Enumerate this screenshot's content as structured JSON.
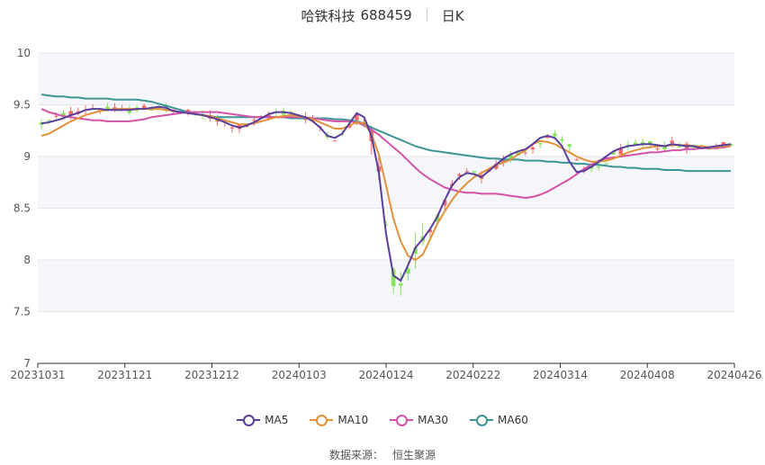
{
  "header": {
    "stock_name": "哈铁科技",
    "stock_code": "688459",
    "period": "日K"
  },
  "footer": {
    "source_label": "数据来源：",
    "source_name": "恒生聚源"
  },
  "colors": {
    "up": "#f26b6b",
    "down": "#86e35a",
    "band": "#f5f6fa",
    "grid": "#e4e6ee"
  },
  "chart_data": {
    "type": "candlestick",
    "y_ticks": [
      "10",
      "9.5",
      "9",
      "8.5",
      "8",
      "7.5",
      "7"
    ],
    "ylim": [
      7,
      10
    ],
    "x_tick_labels": [
      "20231031",
      "20231121",
      "20231212",
      "20240103",
      "20240124",
      "20240222",
      "20240314",
      "20240408",
      "20240426"
    ],
    "legend": [
      {
        "name": "MA5",
        "color": "#5a3e9b"
      },
      {
        "name": "MA10",
        "color": "#e0913a"
      },
      {
        "name": "MA30",
        "color": "#d253a8"
      },
      {
        "name": "MA60",
        "color": "#3e9494"
      }
    ],
    "segments": [
      {
        "from": 0,
        "to": 14,
        "values": [
          9.32,
          9.34,
          9.37,
          9.4,
          9.42,
          9.44,
          9.46,
          9.47,
          9.46,
          9.45,
          9.45,
          9.44,
          9.45,
          9.46,
          9.46
        ]
      },
      {
        "from": 14,
        "to": 28,
        "values": [
          9.46,
          9.47,
          9.49,
          9.47,
          9.44,
          9.43,
          9.42,
          9.41,
          9.4,
          9.38,
          9.36,
          9.33,
          9.3,
          9.28,
          9.3
        ]
      },
      {
        "from": 28,
        "to": 43,
        "values": [
          9.3,
          9.33,
          9.36,
          9.4,
          9.42,
          9.43,
          9.42,
          9.4,
          9.38,
          9.34,
          9.29,
          9.22,
          9.18,
          9.2,
          9.3,
          9.38
        ]
      },
      {
        "from": 43,
        "to": 58,
        "values": [
          9.38,
          9.35,
          9.2,
          8.9,
          8.3,
          7.85,
          7.78,
          7.9,
          8.1,
          8.2,
          8.3,
          8.4,
          8.55,
          8.7,
          8.8,
          8.85
        ]
      },
      {
        "from": 58,
        "to": 80,
        "values": [
          8.85,
          8.83,
          8.8,
          8.85,
          8.9,
          8.95,
          9.0,
          9.03,
          9.05,
          9.1,
          9.15,
          9.18,
          9.2,
          9.18,
          9.1,
          8.95,
          8.85,
          8.87,
          8.9,
          8.95,
          9.02,
          9.05,
          9.08
        ]
      },
      {
        "from": 80,
        "to": 95,
        "values": [
          9.08,
          9.1,
          9.12,
          9.12,
          9.1,
          9.1,
          9.12,
          9.11,
          9.1,
          9.1,
          9.08,
          9.09,
          9.1,
          9.11,
          9.11,
          9.12
        ]
      }
    ],
    "ma5": [
      9.32,
      9.33,
      9.35,
      9.37,
      9.4,
      9.42,
      9.45,
      9.46,
      9.46,
      9.45,
      9.45,
      9.45,
      9.45,
      9.46,
      9.46,
      9.47,
      9.48,
      9.47,
      9.44,
      9.43,
      9.42,
      9.41,
      9.4,
      9.38,
      9.36,
      9.33,
      9.3,
      9.28,
      9.3,
      9.33,
      9.37,
      9.41,
      9.43,
      9.43,
      9.42,
      9.4,
      9.38,
      9.34,
      9.28,
      9.2,
      9.18,
      9.22,
      9.32,
      9.42,
      9.38,
      9.2,
      8.85,
      8.25,
      7.85,
      7.8,
      7.95,
      8.12,
      8.2,
      8.3,
      8.42,
      8.58,
      8.72,
      8.8,
      8.84,
      8.83,
      8.8,
      8.86,
      8.92,
      8.98,
      9.02,
      9.05,
      9.07,
      9.12,
      9.18,
      9.2,
      9.18,
      9.1,
      8.95,
      8.85,
      8.86,
      8.9,
      8.95,
      9.0,
      9.05,
      9.08,
      9.1,
      9.11,
      9.12,
      9.12,
      9.11,
      9.1,
      9.12,
      9.11,
      9.1,
      9.1,
      9.08,
      9.09,
      9.1,
      9.11,
      9.12
    ],
    "ma10": [
      9.2,
      9.22,
      9.26,
      9.3,
      9.34,
      9.37,
      9.4,
      9.42,
      9.44,
      9.45,
      9.46,
      9.46,
      9.46,
      9.46,
      9.46,
      9.46,
      9.46,
      9.45,
      9.44,
      9.43,
      9.42,
      9.41,
      9.4,
      9.39,
      9.37,
      9.35,
      9.33,
      9.31,
      9.31,
      9.32,
      9.34,
      9.36,
      9.38,
      9.39,
      9.4,
      9.39,
      9.38,
      9.36,
      9.33,
      9.3,
      9.27,
      9.27,
      9.3,
      9.33,
      9.32,
      9.22,
      9.02,
      8.72,
      8.4,
      8.18,
      8.04,
      8.0,
      8.05,
      8.2,
      8.35,
      8.47,
      8.58,
      8.67,
      8.74,
      8.8,
      8.84,
      8.88,
      8.92,
      8.94,
      8.97,
      9.02,
      9.06,
      9.12,
      9.15,
      9.14,
      9.12,
      9.08,
      9.04,
      9.0,
      8.97,
      8.95,
      8.95,
      8.96,
      8.98,
      9.01,
      9.04,
      9.06,
      9.08,
      9.09,
      9.1,
      9.1,
      9.11,
      9.11,
      9.11,
      9.1,
      9.1,
      9.09,
      9.09,
      9.1,
      9.1
    ],
    "ma30": [
      9.46,
      9.43,
      9.41,
      9.39,
      9.38,
      9.37,
      9.36,
      9.35,
      9.35,
      9.34,
      9.34,
      9.34,
      9.34,
      9.35,
      9.36,
      9.38,
      9.39,
      9.4,
      9.41,
      9.42,
      9.43,
      9.43,
      9.43,
      9.43,
      9.43,
      9.42,
      9.41,
      9.4,
      9.39,
      9.38,
      9.38,
      9.38,
      9.38,
      9.38,
      9.38,
      9.38,
      9.38,
      9.37,
      9.36,
      9.35,
      9.34,
      9.34,
      9.34,
      9.33,
      9.3,
      9.26,
      9.21,
      9.15,
      9.09,
      9.03,
      8.96,
      8.89,
      8.83,
      8.78,
      8.74,
      8.7,
      8.68,
      8.66,
      8.65,
      8.65,
      8.64,
      8.64,
      8.64,
      8.63,
      8.62,
      8.61,
      8.6,
      8.61,
      8.63,
      8.66,
      8.7,
      8.74,
      8.78,
      8.83,
      8.88,
      8.92,
      8.96,
      8.98,
      8.99,
      9.0,
      9.01,
      9.02,
      9.03,
      9.04,
      9.04,
      9.05,
      9.06,
      9.06,
      9.07,
      9.07,
      9.08,
      9.08,
      9.08,
      9.09,
      9.1
    ],
    "ma60": [
      9.6,
      9.59,
      9.58,
      9.58,
      9.57,
      9.57,
      9.56,
      9.56,
      9.56,
      9.56,
      9.55,
      9.55,
      9.55,
      9.55,
      9.54,
      9.53,
      9.51,
      9.49,
      9.47,
      9.45,
      9.43,
      9.41,
      9.4,
      9.39,
      9.38,
      9.38,
      9.38,
      9.38,
      9.38,
      9.38,
      9.38,
      9.38,
      9.38,
      9.38,
      9.37,
      9.37,
      9.37,
      9.37,
      9.37,
      9.37,
      9.36,
      9.36,
      9.35,
      9.34,
      9.32,
      9.28,
      9.25,
      9.22,
      9.19,
      9.16,
      9.13,
      9.1,
      9.08,
      9.06,
      9.05,
      9.04,
      9.03,
      9.02,
      9.01,
      9.0,
      8.99,
      8.98,
      8.98,
      8.97,
      8.97,
      8.97,
      8.96,
      8.96,
      8.96,
      8.95,
      8.95,
      8.94,
      8.94,
      8.93,
      8.93,
      8.92,
      8.92,
      8.91,
      8.9,
      8.9,
      8.89,
      8.89,
      8.88,
      8.88,
      8.88,
      8.87,
      8.87,
      8.87,
      8.86,
      8.86,
      8.86,
      8.86,
      8.86,
      8.86,
      8.86
    ]
  }
}
